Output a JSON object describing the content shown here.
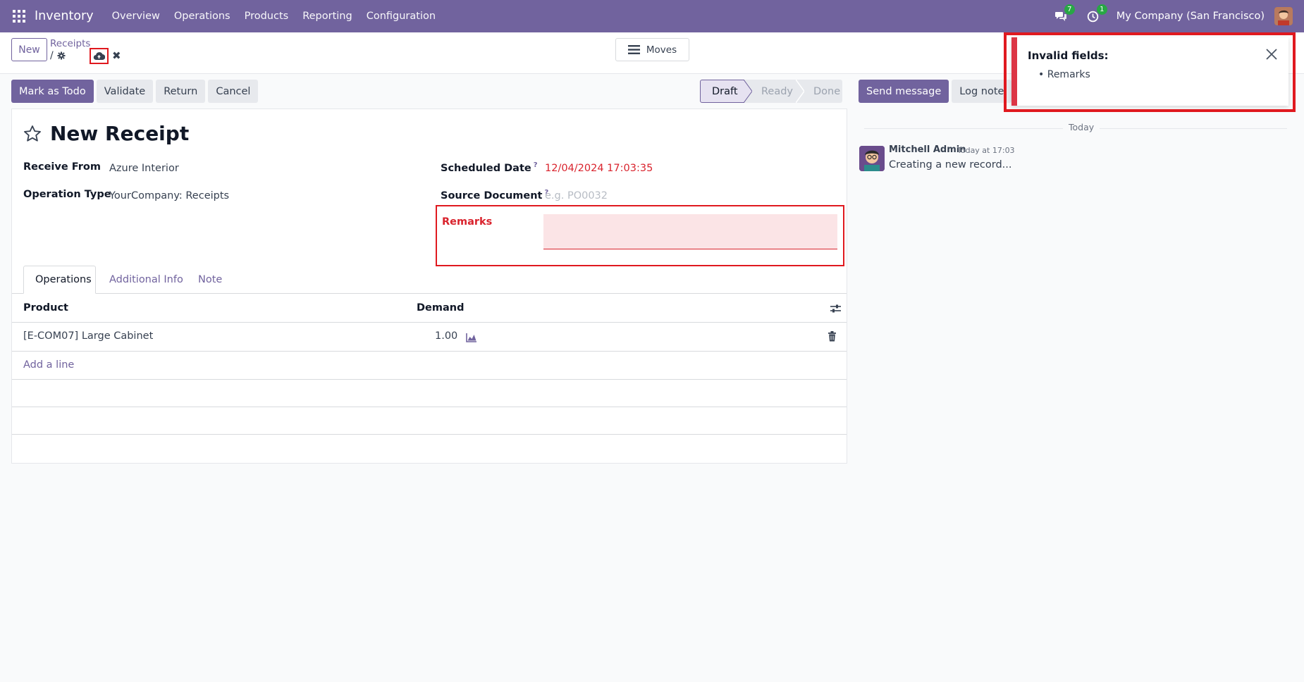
{
  "navbar": {
    "brand": "Inventory",
    "menu": [
      "Overview",
      "Operations",
      "Products",
      "Reporting",
      "Configuration"
    ],
    "messages_count": "7",
    "activities_count": "1",
    "company": "My Company (San Francisco)"
  },
  "control": {
    "new_label": "New",
    "breadcrumb": "Receipts",
    "breadcrumb_sep": "/",
    "moves_label": "Moves"
  },
  "actions": {
    "mark_todo": "Mark as Todo",
    "validate": "Validate",
    "return": "Return",
    "cancel": "Cancel"
  },
  "status": {
    "stages": [
      "Draft",
      "Ready",
      "Done"
    ],
    "current": "Draft"
  },
  "chatter": {
    "send_message": "Send message",
    "log_note": "Log note",
    "date_separator": "Today",
    "message": {
      "author": "Mitchell Admin",
      "time": "Today at 17:03",
      "body": "Creating a new record..."
    }
  },
  "form": {
    "title": "New Receipt",
    "receive_from_label": "Receive From",
    "receive_from_value": "Azure Interior",
    "operation_type_label": "Operation Type",
    "operation_type_value": "YourCompany: Receipts",
    "scheduled_date_label": "Scheduled Date",
    "scheduled_date_value": "12/04/2024 17:03:35",
    "source_document_label": "Source Document",
    "source_document_placeholder": "e.g. PO0032",
    "remarks_label": "Remarks",
    "help_mark": "?"
  },
  "tabs": [
    "Operations",
    "Additional Info",
    "Note"
  ],
  "table": {
    "headers": {
      "product": "Product",
      "demand": "Demand"
    },
    "rows": [
      {
        "product": "[E-COM07] Large Cabinet",
        "demand": "1.00"
      }
    ],
    "add_line": "Add a line"
  },
  "notification": {
    "title": "Invalid fields:",
    "items": [
      "Remarks"
    ]
  },
  "colors": {
    "brand": "#71639e",
    "danger": "#dc3545",
    "highlight": "#e0191f"
  }
}
